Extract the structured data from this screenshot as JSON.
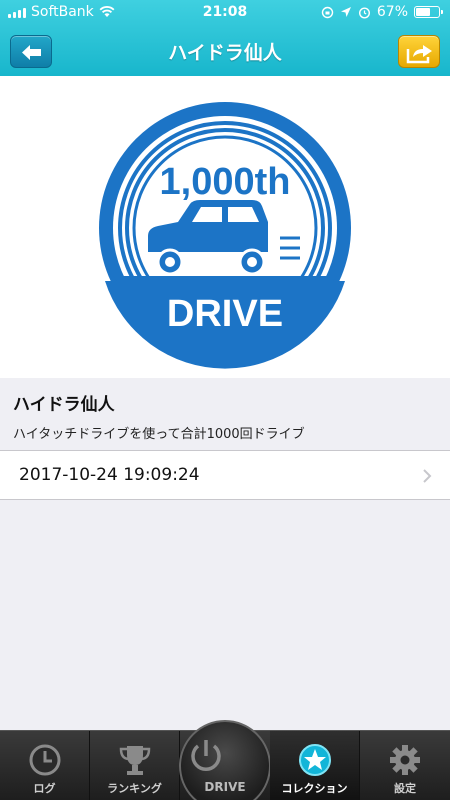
{
  "status_bar": {
    "carrier": "SoftBank",
    "time": "21:08",
    "battery": "67%",
    "battery_level": 0.67
  },
  "nav": {
    "title": "ハイドラ仙人",
    "back_icon": "back-arrow-icon",
    "share_icon": "share-icon"
  },
  "badge": {
    "top_text": "1,000th",
    "bottom_text": "DRIVE",
    "colors": {
      "primary": "#1a75c8",
      "dark": "#0d5fa8",
      "light": "#ffffff"
    }
  },
  "achievement": {
    "title": "ハイドラ仙人",
    "description": "ハイタッチドライブを使って合計1000回ドライブ"
  },
  "record": {
    "datetime": "2017-10-24 19:09:24"
  },
  "tabbar": {
    "tabs": [
      {
        "label": "ログ",
        "icon": "clock-icon"
      },
      {
        "label": "ランキング",
        "icon": "trophy-icon"
      },
      {
        "label": "DRIVE",
        "icon": "power-icon"
      },
      {
        "label": "コレクション",
        "icon": "star-icon",
        "active": true
      },
      {
        "label": "設定",
        "icon": "gear-icon"
      }
    ]
  },
  "colors": {
    "header": "#18b6cc",
    "share_button": "#f2bd14",
    "back_button": "#1690b8"
  }
}
